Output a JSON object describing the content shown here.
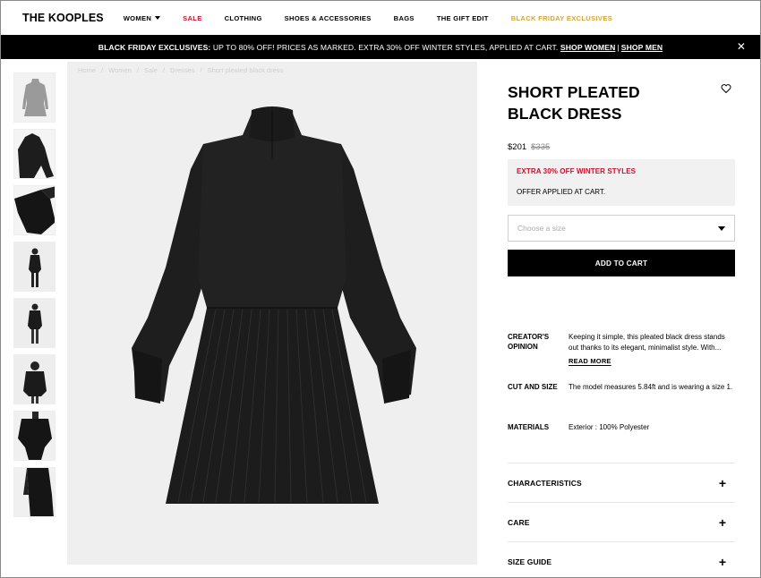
{
  "nav": {
    "logo": "THE KOOPLES",
    "items": [
      {
        "label": "WOMEN",
        "dropdown": true,
        "color": "#000000"
      },
      {
        "label": "SALE",
        "color": "#c8102e"
      },
      {
        "label": "CLOTHING",
        "color": "#000000"
      },
      {
        "label": "SHOES & ACCESSORIES",
        "color": "#000000"
      },
      {
        "label": "BAGS",
        "color": "#000000"
      },
      {
        "label": "THE GIFT EDIT",
        "color": "#000000"
      },
      {
        "label": "BLACK FRIDAY EXCLUSIVES",
        "color": "#d4a63a"
      }
    ]
  },
  "promo": {
    "lead": "BLACK FRIDAY EXCLUSIVES:",
    "text": " UP TO 80% OFF! PRICES AS MARKED. EXTRA 30% OFF WINTER STYLES, APPLIED AT CART. ",
    "link_women": "SHOP WOMEN",
    "separator": "|",
    "link_men": "SHOP MEN",
    "close_icon": "close-icon"
  },
  "breadcrumb": [
    "Home",
    "/",
    "Women",
    "/",
    "Sale",
    "/",
    "Dresses",
    "/",
    "Short pleated black dress"
  ],
  "product": {
    "title": "SHORT PLEATED BLACK DRESS",
    "price": "$201",
    "old_price": "$335",
    "offer_title": "EXTRA 30% OFF WINTER STYLES",
    "offer_note": "OFFER APPLIED AT CART.",
    "size_placeholder": "Choose a size",
    "add_to_cart": "ADD TO CART",
    "attributes": [
      {
        "label": "CREATOR'S OPINION",
        "value": "Keeping it simple, this pleated black dress stands out thanks to its elegant, minimalist style. With..."
      },
      {
        "label": "CUT AND SIZE",
        "value": "The model measures 5.84ft and is wearing a size 1."
      },
      {
        "label": "MATERIALS",
        "value": "Exterior : 100% Polyester"
      }
    ],
    "read_more": "READ MORE",
    "accordions": [
      "CHARACTERISTICS",
      "CARE",
      "SIZE GUIDE"
    ]
  },
  "colors": {
    "accent_red": "#c8102e",
    "gold": "#d4a63a",
    "image_bg": "#efefef",
    "offer_bg": "#f1f1f1"
  }
}
